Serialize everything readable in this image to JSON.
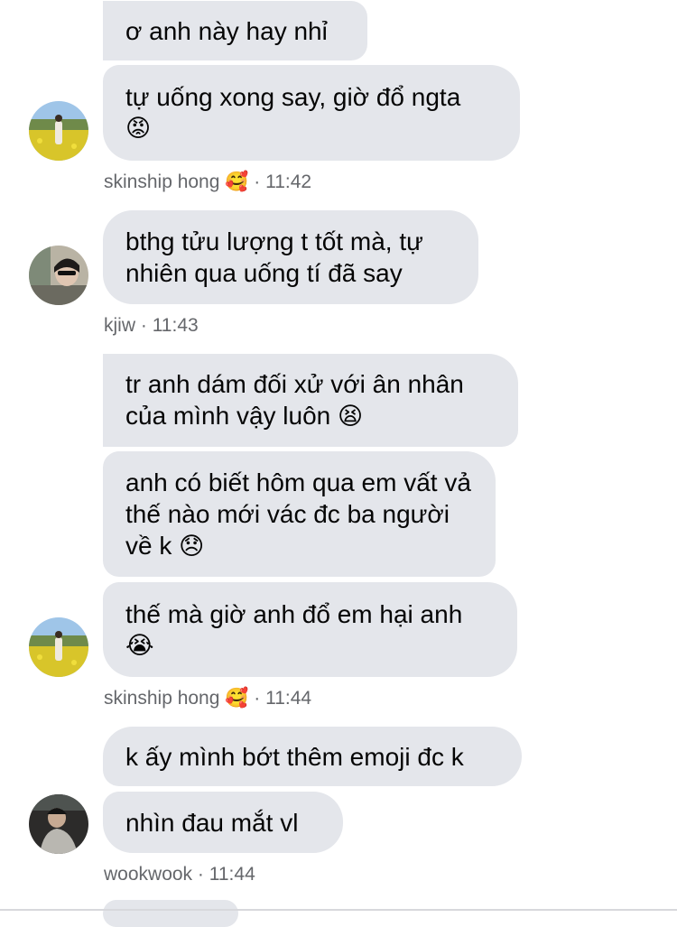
{
  "groups": [
    {
      "sender": "skinship hong",
      "sender_badge": "🥰",
      "time": "11:42",
      "messages": [
        {
          "text": "ơ anh này hay nhỉ",
          "emoji": ""
        },
        {
          "text": "tự uống xong say, giờ đổ ngta",
          "emoji": "😡"
        }
      ]
    },
    {
      "sender": "kjiw",
      "sender_badge": "",
      "time": "11:43",
      "messages": [
        {
          "text": "bthg tửu lượng t tốt mà, tự nhiên qua uống tí đã say",
          "emoji": ""
        }
      ]
    },
    {
      "sender": "skinship hong",
      "sender_badge": "🥰",
      "time": "11:44",
      "messages": [
        {
          "text": "tr anh dám đối xử với ân nhân của mình vậy luôn",
          "emoji": "😫"
        },
        {
          "text": "anh có biết hôm qua em vất vả thế nào mới vác đc ba người về k",
          "emoji": "😞"
        },
        {
          "text": "thế mà giờ anh đổ em hại anh",
          "emoji": "😭"
        }
      ]
    },
    {
      "sender": "wookwook",
      "sender_badge": "",
      "time": "11:44",
      "messages": [
        {
          "text": "k ấy mình bớt thêm emoji đc k",
          "emoji": ""
        },
        {
          "text": "nhìn đau mắt vl",
          "emoji": ""
        }
      ]
    }
  ],
  "meta_separator": "·",
  "colors": {
    "bubble": "#e4e6eb",
    "meta_text": "#65676b",
    "message_text": "#050505"
  },
  "avatars": [
    "field-photo-avatar",
    "sunglasses-photo-avatar",
    "field-photo-avatar",
    "dark-photo-avatar"
  ]
}
